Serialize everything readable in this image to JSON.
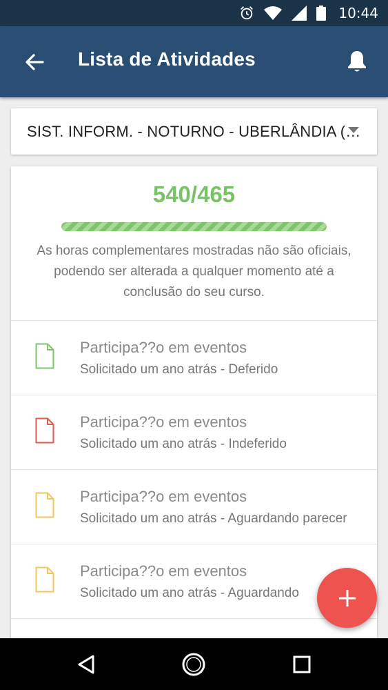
{
  "status_bar": {
    "time": "10:44",
    "icons": [
      "alarm-icon",
      "wifi-icon",
      "signal-icon",
      "battery-icon"
    ]
  },
  "app_bar": {
    "title": "Lista de Atividades",
    "back_icon": "arrow-back-icon",
    "notifications_icon": "bell-icon"
  },
  "course_select": {
    "selected": "SIST. INFORM. - NOTURNO - UBERLÂNDIA (…"
  },
  "summary": {
    "hours": "540/465",
    "progress_fraction": 1.0,
    "disclaimer": "As horas complementares mostradas não são oficiais, podendo ser alterada a qualquer momento até a conclusão do seu curso."
  },
  "activities": [
    {
      "title": "Participa??o em eventos",
      "subtitle": "Solicitado um ano atrás - Deferido",
      "icon": "document-icon",
      "status_color": "#7cc56a"
    },
    {
      "title": "Participa??o em eventos",
      "subtitle": "Solicitado um ano atrás - Indeferido",
      "icon": "document-icon",
      "status_color": "#e05a52"
    },
    {
      "title": "Participa??o em eventos",
      "subtitle": "Solicitado um ano atrás - Aguardando parecer",
      "icon": "document-icon",
      "status_color": "#f2c55c"
    },
    {
      "title": "Participa??o em eventos",
      "subtitle": "Solicitado um ano atrás - Aguardando",
      "icon": "document-icon",
      "status_color": "#f2c55c"
    }
  ],
  "fab": {
    "icon": "plus-icon",
    "color": "#ef5350"
  },
  "nav_bar": {
    "icons": [
      "back-triangle-icon",
      "home-circle-icon",
      "recents-square-icon"
    ]
  },
  "colors": {
    "primary": "#2a4e73",
    "status_bar": "#1b3349",
    "accent_green": "#79c266"
  }
}
